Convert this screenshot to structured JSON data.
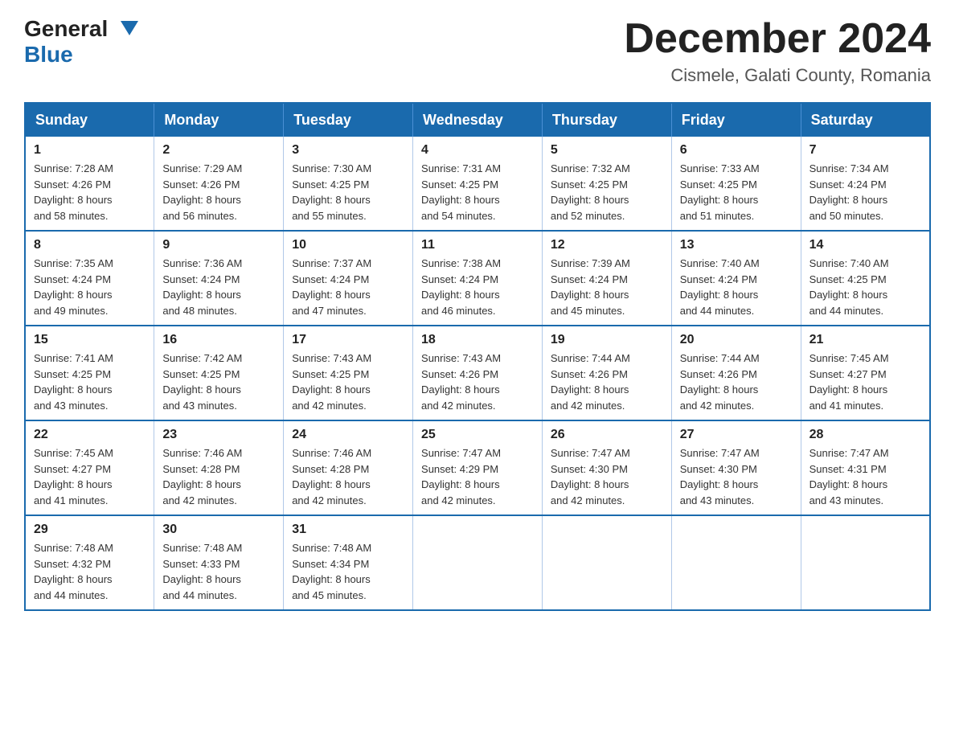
{
  "header": {
    "logo": {
      "general": "General",
      "blue": "Blue",
      "arrow": "▼"
    },
    "title": "December 2024",
    "subtitle": "Cismele, Galati County, Romania"
  },
  "days_of_week": [
    "Sunday",
    "Monday",
    "Tuesday",
    "Wednesday",
    "Thursday",
    "Friday",
    "Saturday"
  ],
  "weeks": [
    [
      {
        "day": "1",
        "sunrise": "7:28 AM",
        "sunset": "4:26 PM",
        "daylight": "8 hours and 58 minutes."
      },
      {
        "day": "2",
        "sunrise": "7:29 AM",
        "sunset": "4:26 PM",
        "daylight": "8 hours and 56 minutes."
      },
      {
        "day": "3",
        "sunrise": "7:30 AM",
        "sunset": "4:25 PM",
        "daylight": "8 hours and 55 minutes."
      },
      {
        "day": "4",
        "sunrise": "7:31 AM",
        "sunset": "4:25 PM",
        "daylight": "8 hours and 54 minutes."
      },
      {
        "day": "5",
        "sunrise": "7:32 AM",
        "sunset": "4:25 PM",
        "daylight": "8 hours and 52 minutes."
      },
      {
        "day": "6",
        "sunrise": "7:33 AM",
        "sunset": "4:25 PM",
        "daylight": "8 hours and 51 minutes."
      },
      {
        "day": "7",
        "sunrise": "7:34 AM",
        "sunset": "4:24 PM",
        "daylight": "8 hours and 50 minutes."
      }
    ],
    [
      {
        "day": "8",
        "sunrise": "7:35 AM",
        "sunset": "4:24 PM",
        "daylight": "8 hours and 49 minutes."
      },
      {
        "day": "9",
        "sunrise": "7:36 AM",
        "sunset": "4:24 PM",
        "daylight": "8 hours and 48 minutes."
      },
      {
        "day": "10",
        "sunrise": "7:37 AM",
        "sunset": "4:24 PM",
        "daylight": "8 hours and 47 minutes."
      },
      {
        "day": "11",
        "sunrise": "7:38 AM",
        "sunset": "4:24 PM",
        "daylight": "8 hours and 46 minutes."
      },
      {
        "day": "12",
        "sunrise": "7:39 AM",
        "sunset": "4:24 PM",
        "daylight": "8 hours and 45 minutes."
      },
      {
        "day": "13",
        "sunrise": "7:40 AM",
        "sunset": "4:24 PM",
        "daylight": "8 hours and 44 minutes."
      },
      {
        "day": "14",
        "sunrise": "7:40 AM",
        "sunset": "4:25 PM",
        "daylight": "8 hours and 44 minutes."
      }
    ],
    [
      {
        "day": "15",
        "sunrise": "7:41 AM",
        "sunset": "4:25 PM",
        "daylight": "8 hours and 43 minutes."
      },
      {
        "day": "16",
        "sunrise": "7:42 AM",
        "sunset": "4:25 PM",
        "daylight": "8 hours and 43 minutes."
      },
      {
        "day": "17",
        "sunrise": "7:43 AM",
        "sunset": "4:25 PM",
        "daylight": "8 hours and 42 minutes."
      },
      {
        "day": "18",
        "sunrise": "7:43 AM",
        "sunset": "4:26 PM",
        "daylight": "8 hours and 42 minutes."
      },
      {
        "day": "19",
        "sunrise": "7:44 AM",
        "sunset": "4:26 PM",
        "daylight": "8 hours and 42 minutes."
      },
      {
        "day": "20",
        "sunrise": "7:44 AM",
        "sunset": "4:26 PM",
        "daylight": "8 hours and 42 minutes."
      },
      {
        "day": "21",
        "sunrise": "7:45 AM",
        "sunset": "4:27 PM",
        "daylight": "8 hours and 41 minutes."
      }
    ],
    [
      {
        "day": "22",
        "sunrise": "7:45 AM",
        "sunset": "4:27 PM",
        "daylight": "8 hours and 41 minutes."
      },
      {
        "day": "23",
        "sunrise": "7:46 AM",
        "sunset": "4:28 PM",
        "daylight": "8 hours and 42 minutes."
      },
      {
        "day": "24",
        "sunrise": "7:46 AM",
        "sunset": "4:28 PM",
        "daylight": "8 hours and 42 minutes."
      },
      {
        "day": "25",
        "sunrise": "7:47 AM",
        "sunset": "4:29 PM",
        "daylight": "8 hours and 42 minutes."
      },
      {
        "day": "26",
        "sunrise": "7:47 AM",
        "sunset": "4:30 PM",
        "daylight": "8 hours and 42 minutes."
      },
      {
        "day": "27",
        "sunrise": "7:47 AM",
        "sunset": "4:30 PM",
        "daylight": "8 hours and 43 minutes."
      },
      {
        "day": "28",
        "sunrise": "7:47 AM",
        "sunset": "4:31 PM",
        "daylight": "8 hours and 43 minutes."
      }
    ],
    [
      {
        "day": "29",
        "sunrise": "7:48 AM",
        "sunset": "4:32 PM",
        "daylight": "8 hours and 44 minutes."
      },
      {
        "day": "30",
        "sunrise": "7:48 AM",
        "sunset": "4:33 PM",
        "daylight": "8 hours and 44 minutes."
      },
      {
        "day": "31",
        "sunrise": "7:48 AM",
        "sunset": "4:34 PM",
        "daylight": "8 hours and 45 minutes."
      },
      null,
      null,
      null,
      null
    ]
  ]
}
